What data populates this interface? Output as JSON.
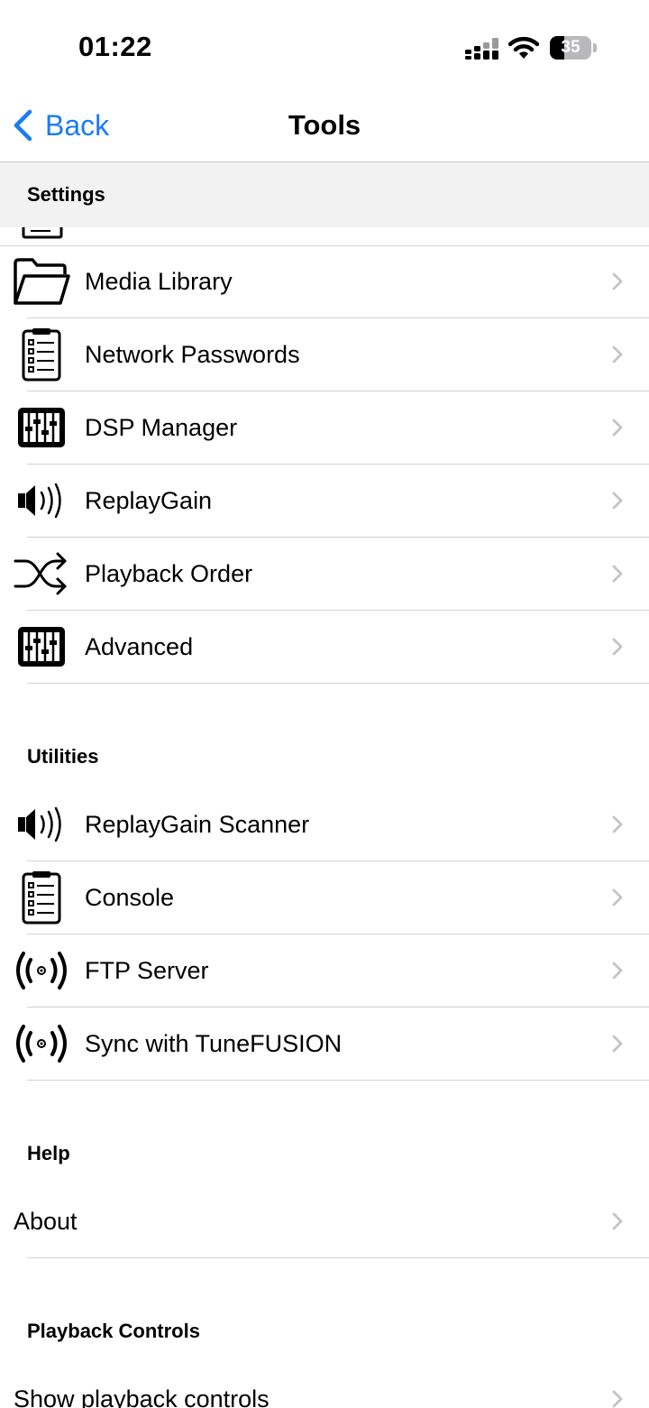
{
  "status_bar": {
    "time": "01:22",
    "battery_level": 35,
    "battery_text": "35"
  },
  "nav": {
    "back_label": "Back",
    "title": "Tools"
  },
  "sections": [
    {
      "header": "Settings",
      "items": [
        {
          "label": "Media Library",
          "icon": "folder-icon"
        },
        {
          "label": "Network Passwords",
          "icon": "clipboard-list-icon"
        },
        {
          "label": "DSP Manager",
          "icon": "equalizer-sliders-icon"
        },
        {
          "label": "ReplayGain",
          "icon": "speaker-volume-icon"
        },
        {
          "label": "Playback Order",
          "icon": "shuffle-icon"
        },
        {
          "label": "Advanced",
          "icon": "equalizer-sliders-icon"
        }
      ]
    },
    {
      "header": "Utilities",
      "items": [
        {
          "label": "ReplayGain Scanner",
          "icon": "speaker-volume-icon"
        },
        {
          "label": "Console",
          "icon": "clipboard-list-icon"
        },
        {
          "label": "FTP Server",
          "icon": "broadcast-icon"
        },
        {
          "label": "Sync with TuneFUSION",
          "icon": "broadcast-icon"
        }
      ]
    },
    {
      "header": "Help",
      "items": [
        {
          "label": "About"
        }
      ]
    },
    {
      "header": "Playback Controls",
      "items": [
        {
          "label": "Show playback controls"
        }
      ]
    }
  ],
  "colors": {
    "accent": "#1a7cf5",
    "separator": "#d1d1d6",
    "chevron": "#c4c4c6",
    "section_header_bg": "#f2f2f2"
  }
}
